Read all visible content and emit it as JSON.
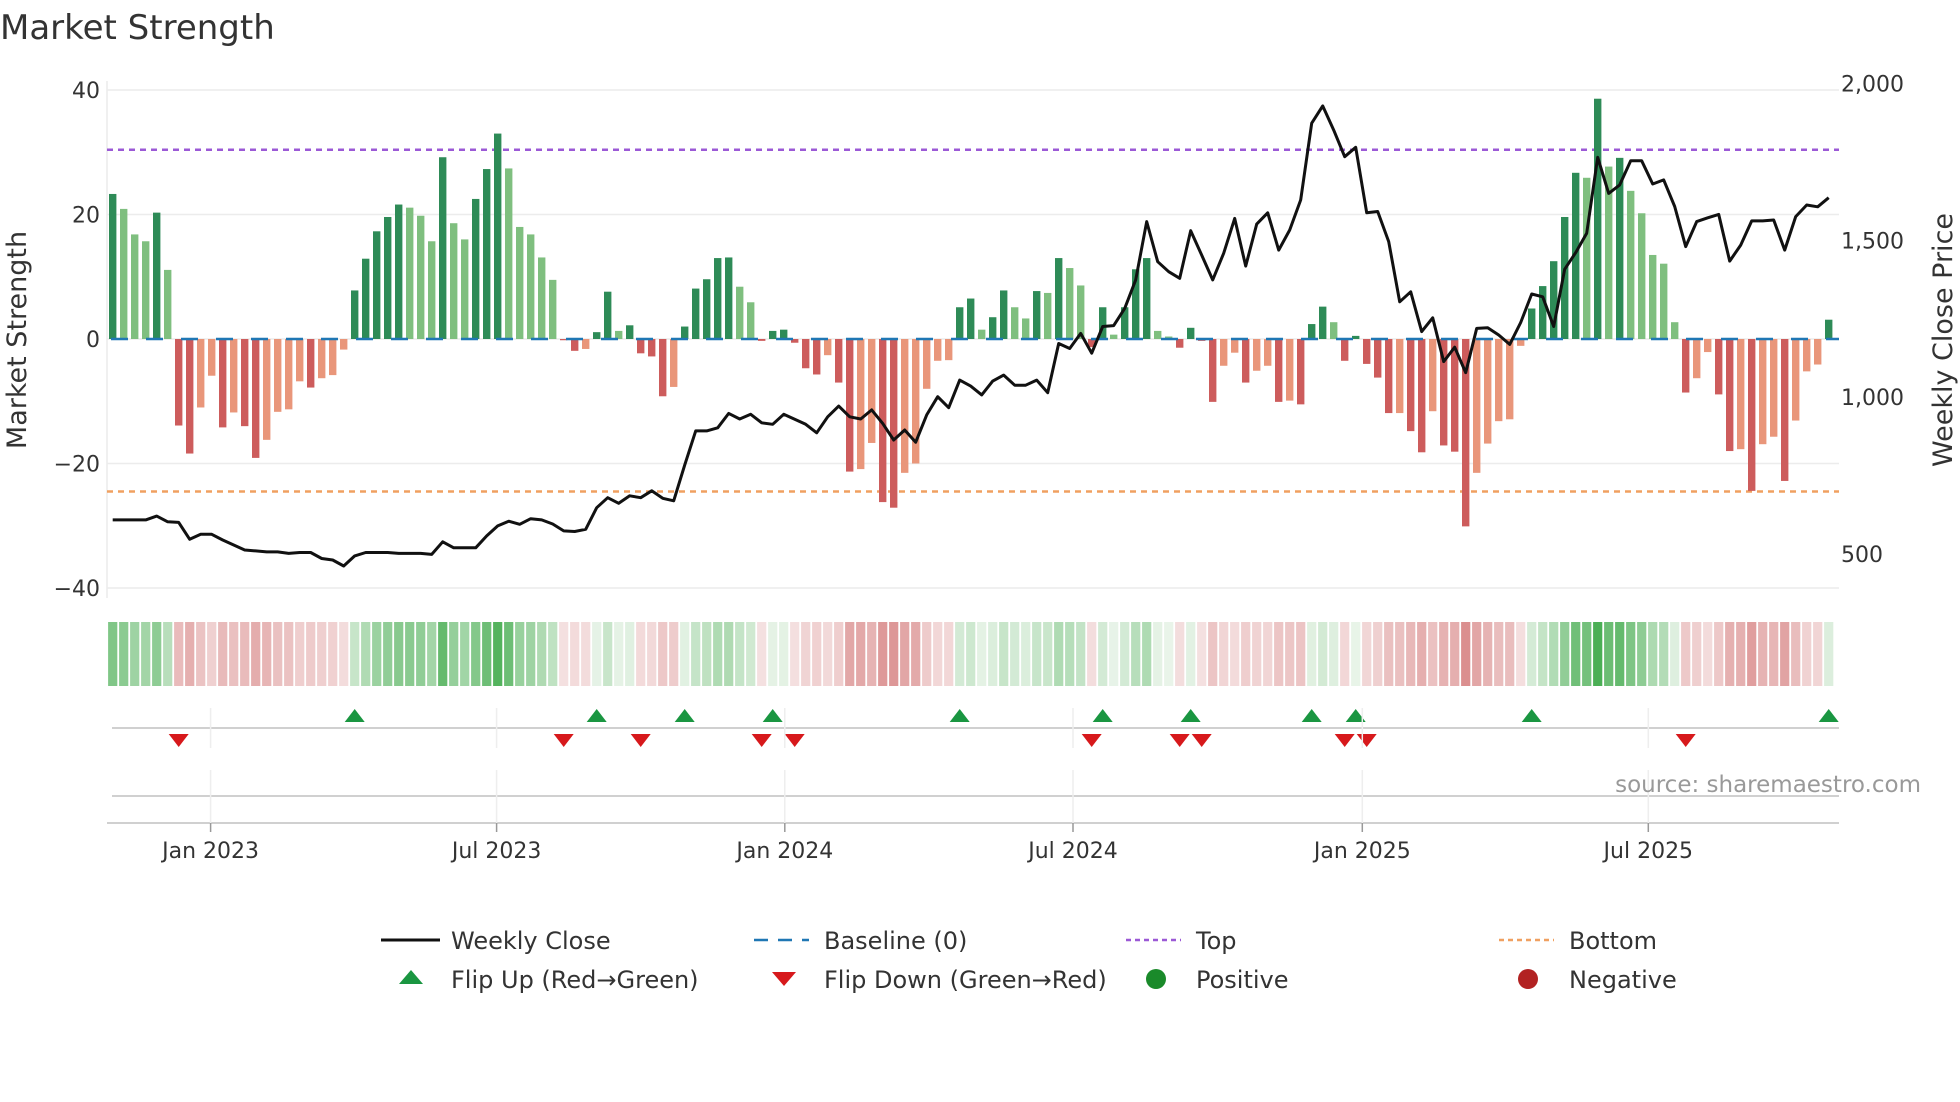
{
  "chart_data": {
    "type": "bar",
    "title": "Market Strength",
    "ylabel": "Market Strength",
    "y2label": "Weekly Close Price",
    "ylim": [
      -42,
      42
    ],
    "y2lim": [
      400,
      2080
    ],
    "yticks": [
      40,
      20,
      0,
      -20,
      -40
    ],
    "ytick_labels": [
      "40",
      "20",
      "0",
      "−20",
      "−40"
    ],
    "y2ticks": [
      2000,
      1500,
      1000,
      500
    ],
    "y2tick_labels": [
      "2,000",
      "1,500",
      "1,000",
      "500"
    ],
    "x_unit": "week index",
    "xticks": [
      8.9,
      34.9,
      61.1,
      87.3,
      113.6,
      139.6
    ],
    "xtick_labels": [
      "Jan 2023",
      "Jul 2023",
      "Jan 2024",
      "Jul 2024",
      "Jan 2025",
      "Jul 2025"
    ],
    "grid": true,
    "top_level": 30.4,
    "bottom_level": -24.5,
    "baseline": 0,
    "strength": [
      23.3,
      20.9,
      16.8,
      15.7,
      20.3,
      11.1,
      -13.9,
      -18.4,
      -11,
      -5.9,
      -14.2,
      -11.8,
      -14,
      -19.1,
      -16.2,
      -11.7,
      -11.3,
      -6.8,
      -7.8,
      -6.3,
      -5.8,
      -1.7,
      7.8,
      12.9,
      17.3,
      19.6,
      21.6,
      21.1,
      19.8,
      15.7,
      29.2,
      18.6,
      16,
      22.5,
      27.3,
      33,
      27.4,
      18,
      16.8,
      13.1,
      9.5,
      -0.2,
      -1.9,
      -1.6,
      1.1,
      7.6,
      1.3,
      2.2,
      -2.3,
      -2.8,
      -9.2,
      -7.7,
      2,
      8.1,
      9.6,
      13,
      13.1,
      8.4,
      5.9,
      -0.3,
      1.3,
      1.5,
      -0.6,
      -4.7,
      -5.7,
      -2.6,
      -7,
      -21.3,
      -20.9,
      -16.7,
      -26.2,
      -27.1,
      -21.5,
      -20,
      -8,
      -3.5,
      -3.4,
      5.1,
      6.5,
      1.5,
      3.5,
      7.8,
      5.1,
      3.3,
      7.7,
      7.4,
      13,
      11.4,
      8.6,
      -1.3,
      5.1,
      0.7,
      5.1,
      11.2,
      13,
      1.3,
      0.4,
      -1.4,
      1.8,
      -0.3,
      -10.1,
      -4.3,
      -2.2,
      -7,
      -5.1,
      -4.3,
      -10.1,
      -9.9,
      -10.5,
      2.4,
      5.2,
      2.7,
      -3.5,
      0.5,
      -4,
      -6.2,
      -11.9,
      -11.9,
      -14.8,
      -18.2,
      -11.6,
      -17.1,
      -18.1,
      -30.1,
      -21.5,
      -16.8,
      -13.2,
      -12.9,
      -1.1,
      4.9,
      8.5,
      12.5,
      19.6,
      26.7,
      25.9,
      38.6,
      27.7,
      29.1,
      23.8,
      20.2,
      13.5,
      12.1,
      2.7,
      -8.6,
      -6.3,
      -2.1,
      -8.9,
      -18,
      -17.7,
      -24.4,
      -16.9,
      -15.7,
      -22.8,
      -13.1,
      -5.2,
      -4.1,
      3.1
    ],
    "weekly_close": [
      608,
      608,
      608,
      608,
      620,
      602,
      600,
      546,
      562,
      562,
      544,
      528,
      512,
      509,
      506,
      506,
      501,
      504,
      504,
      485,
      480,
      461,
      493,
      504,
      504,
      504,
      501,
      501,
      501,
      498,
      538,
      519,
      519,
      519,
      557,
      589,
      604,
      594,
      612,
      608,
      595,
      573,
      571,
      578,
      647,
      679,
      661,
      685,
      679,
      701,
      677,
      669,
      783,
      892,
      892,
      902,
      948,
      930,
      945,
      918,
      913,
      945,
      929,
      913,
      886,
      937,
      971,
      937,
      930,
      959,
      916,
      863,
      895,
      856,
      943,
      1001,
      966,
      1054,
      1035,
      1007,
      1051,
      1070,
      1038,
      1038,
      1054,
      1014,
      1171,
      1155,
      1203,
      1140,
      1225,
      1228,
      1283,
      1374,
      1560,
      1432,
      1400,
      1379,
      1531,
      1453,
      1374,
      1459,
      1570,
      1418,
      1552,
      1588,
      1469,
      1533,
      1629,
      1874,
      1929,
      1852,
      1767,
      1797,
      1588,
      1592,
      1496,
      1304,
      1336,
      1209,
      1253,
      1113,
      1159,
      1078,
      1219,
      1221,
      1198,
      1168,
      1238,
      1329,
      1320,
      1225,
      1408,
      1461,
      1523,
      1765,
      1650,
      1677,
      1754,
      1754,
      1680,
      1693,
      1608,
      1480,
      1560,
      1572,
      1583,
      1434,
      1485,
      1562,
      1562,
      1565,
      1469,
      1576,
      1613,
      1607,
      1636
    ],
    "flip_up": [
      22,
      44,
      52,
      60,
      77,
      90,
      98,
      109,
      113,
      129,
      156
    ],
    "flip_down": [
      6,
      41,
      48,
      59,
      62,
      89,
      97,
      99,
      112,
      114,
      143
    ],
    "colors": {
      "pos_strong": "#2e8b57",
      "pos_weak": "#7fbf7f",
      "neg_strong": "#cd5c5c",
      "neg_weak": "#e9967a",
      "line": "#111111",
      "baseline": "#1f77b4",
      "top": "#9b59d6",
      "bottom": "#f0a060",
      "flip_up": "#1a9641",
      "flip_down": "#d7191c",
      "positive": "#1a8a2a",
      "negative": "#b22222"
    },
    "legend": {
      "placement": "bottom",
      "items": [
        {
          "label": "Weekly Close"
        },
        {
          "label": "Baseline (0)"
        },
        {
          "label": "Top"
        },
        {
          "label": "Bottom"
        },
        {
          "label": "Flip Up (Red→Green)"
        },
        {
          "label": "Flip Down (Green→Red)"
        },
        {
          "label": "Positive"
        },
        {
          "label": "Negative"
        }
      ]
    },
    "source": "source: sharemaestro.com"
  }
}
